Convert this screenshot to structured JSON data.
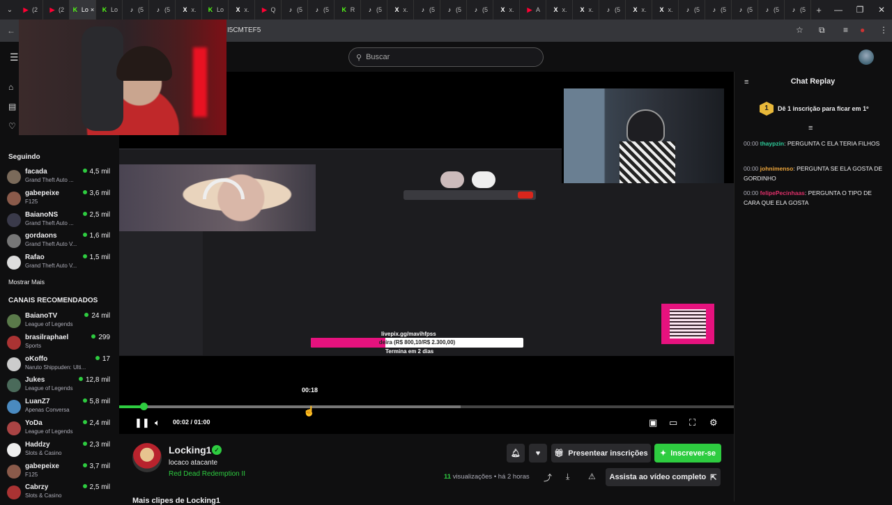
{
  "browser": {
    "tabs": [
      {
        "icon": "youtube-icon",
        "label": "(2",
        "color": "#ff0033"
      },
      {
        "icon": "youtube-icon",
        "label": "(2",
        "color": "#ff0033"
      },
      {
        "icon": "kick-icon",
        "label": "Lo",
        "color": "#53fc18",
        "active": true
      },
      {
        "icon": "kick-icon",
        "label": "Lo",
        "color": "#53fc18"
      },
      {
        "icon": "tiktok-icon",
        "label": "(5",
        "color": "#ffffff"
      },
      {
        "icon": "tiktok-icon",
        "label": "(5",
        "color": "#ffffff"
      },
      {
        "icon": "x-icon",
        "label": "x.",
        "color": "#ffffff"
      },
      {
        "icon": "kick-icon",
        "label": "Lo",
        "color": "#53fc18"
      },
      {
        "icon": "x-icon",
        "label": "x.",
        "color": "#ffffff"
      },
      {
        "icon": "youtube-icon",
        "label": "Q",
        "color": "#ff0033"
      },
      {
        "icon": "tiktok-icon",
        "label": "(5",
        "color": "#ffffff"
      },
      {
        "icon": "tiktok-icon",
        "label": "(5",
        "color": "#ffffff"
      },
      {
        "icon": "kick-icon",
        "label": "R",
        "color": "#53fc18"
      },
      {
        "icon": "tiktok-icon",
        "label": "(5",
        "color": "#ffffff"
      },
      {
        "icon": "x-icon",
        "label": "x.",
        "color": "#ffffff"
      },
      {
        "icon": "tiktok-icon",
        "label": "(5",
        "color": "#ffffff"
      },
      {
        "icon": "tiktok-icon",
        "label": "(5",
        "color": "#ffffff"
      },
      {
        "icon": "tiktok-icon",
        "label": "(5",
        "color": "#ffffff"
      },
      {
        "icon": "x-icon",
        "label": "x.",
        "color": "#ffffff"
      },
      {
        "icon": "youtube-icon",
        "label": "A",
        "color": "#ff0033"
      },
      {
        "icon": "x-icon",
        "label": "x.",
        "color": "#ffffff"
      },
      {
        "icon": "x-icon",
        "label": "x.",
        "color": "#ffffff"
      },
      {
        "icon": "tiktok-icon",
        "label": "(5",
        "color": "#ffffff"
      },
      {
        "icon": "x-icon",
        "label": "x.",
        "color": "#ffffff"
      },
      {
        "icon": "x-icon",
        "label": "x.",
        "color": "#ffffff"
      },
      {
        "icon": "tiktok-icon",
        "label": "(5",
        "color": "#ffffff"
      },
      {
        "icon": "tiktok-icon",
        "label": "(5",
        "color": "#ffffff"
      },
      {
        "icon": "tiktok-icon",
        "label": "(5",
        "color": "#ffffff"
      },
      {
        "icon": "tiktok-icon",
        "label": "(5",
        "color": "#ffffff"
      },
      {
        "icon": "tiktok-icon",
        "label": "(5",
        "color": "#ffffff"
      }
    ],
    "new_tab": "+",
    "url_fragment": "I5CMTEF5",
    "close_tab": "×"
  },
  "nav": {
    "search_placeholder": "Buscar"
  },
  "sidebar": {
    "following_title": "Seguindo",
    "following": [
      {
        "name": "facada",
        "game": "Grand Theft Auto ...",
        "viewers": "4,5 mil",
        "color": "#7a6a5a"
      },
      {
        "name": "gabepeixe",
        "game": "F125",
        "viewers": "3,6 mil",
        "color": "#8a5a4a"
      },
      {
        "name": "BaianoNS",
        "game": "Grand Theft Auto ...",
        "viewers": "2,5 mil",
        "color": "#3a3a4a"
      },
      {
        "name": "gordaons",
        "game": "Grand Theft Auto V...",
        "viewers": "1,6 mil",
        "color": "#777"
      },
      {
        "name": "Rafao",
        "game": "Grand Theft Auto V...",
        "viewers": "1,5 mil",
        "color": "#ddd"
      }
    ],
    "show_more": "Mostrar Mais",
    "recommended_title": "CANAIS RECOMENDADOS",
    "recommended": [
      {
        "name": "BaianoTV",
        "game": "League of Legends",
        "viewers": "24 mil",
        "color": "#5a7a4a"
      },
      {
        "name": "brasilraphael",
        "game": "Sports",
        "viewers": "299",
        "color": "#a33"
      },
      {
        "name": "oKoffo",
        "game": "Naruto Shippuden: Ulti...",
        "viewers": "17",
        "color": "#ccc"
      },
      {
        "name": "Jukes",
        "game": "League of Legends",
        "viewers": "12,8 mil",
        "color": "#4a6a5a"
      },
      {
        "name": "LuanZ7",
        "game": "Apenas Conversa",
        "viewers": "5,8 mil",
        "color": "#4a8ac0"
      },
      {
        "name": "YoDa",
        "game": "League of Legends",
        "viewers": "2,4 mil",
        "color": "#a44"
      },
      {
        "name": "Haddzy",
        "game": "Slots & Casino",
        "viewers": "2,3 mil",
        "color": "#eee"
      },
      {
        "name": "gabepeixe",
        "game": "F125",
        "viewers": "3,7 mil",
        "color": "#8a5a4a"
      },
      {
        "name": "Cabrzy",
        "game": "Slots & Casino",
        "viewers": "2,5 mil",
        "color": "#a33"
      }
    ]
  },
  "video": {
    "overlay_url": "livepix.gg/mavihfpss",
    "goal_text": "deira (R$ 800,10/R$ 2.300,00)",
    "goal_progress": 0.35,
    "goal_end": "Termina em 2 dias",
    "hover_time": "00:18",
    "current_time": "00:02",
    "duration": "01:00",
    "played_fraction": 0.04,
    "buffered_fraction": 0.555,
    "hover_fraction": 0.306
  },
  "chat": {
    "title": "Chat Replay",
    "sub_prompt": "Dê 1 inscrição para ficar em 1º",
    "sub_rank": "1",
    "messages": [
      {
        "time": "00:00",
        "user": "thaypzin",
        "user_color": "#2ecc9a",
        "text": ": PERGUNTA C ELA TERIA FILHOS"
      },
      {
        "time": "00:00",
        "user": "johnimenso",
        "user_color": "#e8a23a",
        "text": ": PERGUNTA SE ELA GOSTA DE GORDINHO"
      },
      {
        "time": "00:00",
        "user": "felipePecinhaas",
        "user_color": "#e0306a",
        "text": ": PERGUNTA O TIPO DE CARA QUE ELA GOSTA"
      }
    ]
  },
  "channel": {
    "name": "Locking1",
    "clip_title": "locaco atacante",
    "game": "Red Dead Redemption II",
    "gift_label": "Presentear inscrições",
    "subscribe_label": "Inscrever-se",
    "views_count": "11",
    "views_label": "visualizações",
    "age": "• há 2 horas",
    "watch_full": "Assista ao vídeo completo",
    "more_clips": "Mais clipes de Locking1"
  },
  "colors": {
    "accent": "#2ecc40",
    "bg": "#0f0f10"
  }
}
